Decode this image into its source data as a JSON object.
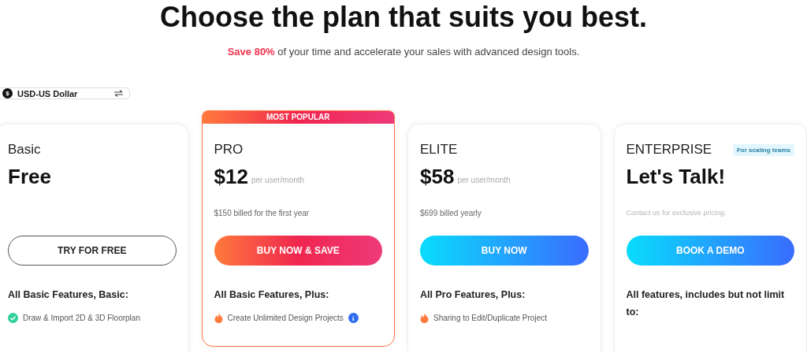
{
  "heading": "Choose the plan that suits you best.",
  "subheading": "**Save 80%** of your time and accelerate your sales with advanced design tools.",
  "currency": {
    "icon_label": "$",
    "value": "USD-US Dollar"
  },
  "plans": [
    {
      "kind": "outline",
      "name": "Basic",
      "price": "Free",
      "button": "TRY FOR FREE",
      "features_heading": "All Basic Features, Basic:",
      "features": [
        {
          "kind": "check",
          "text": "Draw & Import 2D & 3D Floorplan",
          "info": false
        }
      ]
    },
    {
      "kind": "orange",
      "name": "PRO",
      "price": "$12",
      "unit": "per user/month",
      "badge": "MOST POPULAR",
      "billing": "$150 billed for the first year",
      "billing_muted": false,
      "button": "BUY NOW & SAVE",
      "features_heading": "All Basic Features, Plus:",
      "features": [
        {
          "kind": "fire",
          "text": "Create Unlimited Design Projects",
          "info": true,
          "info_label": "i"
        }
      ]
    },
    {
      "kind": "blue",
      "name": "ELITE",
      "price": "$58",
      "unit": "per user/month",
      "billing": "$699 billed yearly",
      "billing_muted": false,
      "button": "BUY NOW",
      "features_heading": "All Pro Features, Plus:",
      "features": [
        {
          "kind": "fire",
          "text": "Sharing to Edit/Duplicate Project",
          "info": false
        }
      ]
    },
    {
      "kind": "blue",
      "name": "ENTERPRISE",
      "price": "Let's Talk!",
      "tag": "For scaling teams",
      "billing": "Contact us for exclusive pricing.",
      "billing_muted": true,
      "button": "BOOK A DEMO",
      "features_heading": "All features, includes but not limit to:"
    }
  ]
}
